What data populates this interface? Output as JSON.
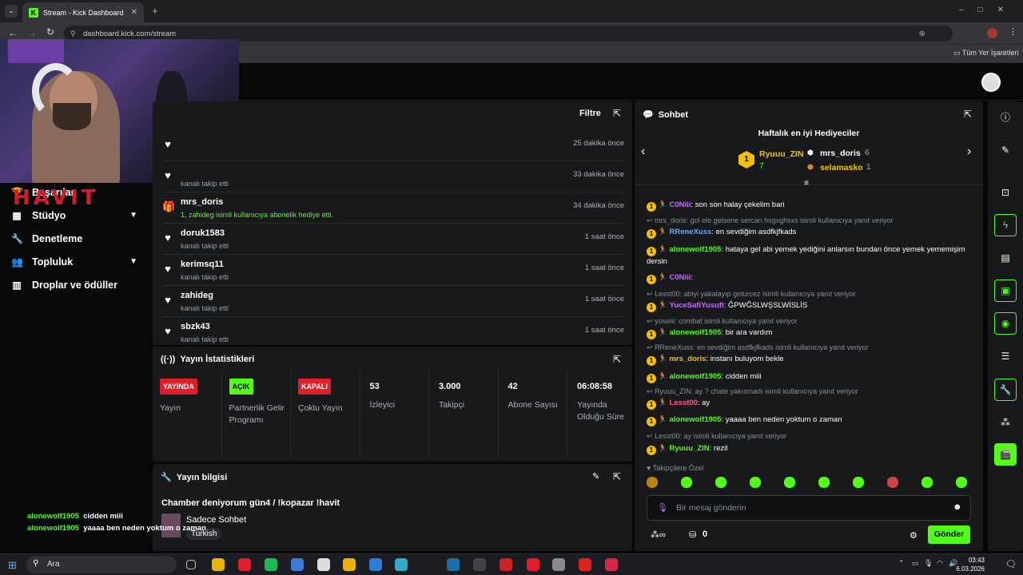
{
  "browser": {
    "tab_title": "Stream - Kick Dashboard",
    "url": "dashboard.kick.com/stream",
    "bookmarks_label": "Tüm Yer İşaretleri"
  },
  "sidebar": {
    "brand": "HAVIT",
    "items": [
      {
        "label": "Başarılar",
        "icon": "trophy-icon"
      },
      {
        "label": "Stüdyo",
        "icon": "studio-icon",
        "chevron": true
      },
      {
        "label": "Denetleme",
        "icon": "wrench-icon"
      },
      {
        "label": "Topluluk",
        "icon": "community-icon",
        "chevron": true
      },
      {
        "label": "Droplar ve ödüller",
        "icon": "drops-icon"
      }
    ]
  },
  "activity": {
    "filter_label": "Filtre",
    "items": [
      {
        "name": "",
        "sub": "",
        "time": "25 dakika önce",
        "icon": "heart-icon"
      },
      {
        "name": "",
        "sub": "kanalı takip etti",
        "time": "33 dakika önce",
        "icon": "heart-icon"
      },
      {
        "name": "mrs_doris",
        "sub": "1, zahideg isimli kullanıcıya abonelik hediye etti.",
        "time": "34 dakika önce",
        "icon": "gift-icon"
      },
      {
        "name": "doruk1583",
        "sub": "kanalı takip etti",
        "time": "1 saat önce",
        "icon": "heart-icon"
      },
      {
        "name": "kerimsq11",
        "sub": "kanalı takip etti",
        "time": "1 saat önce",
        "icon": "heart-icon"
      },
      {
        "name": "zahideg",
        "sub": "kanalı takip etti",
        "time": "1 saat önce",
        "icon": "heart-icon"
      },
      {
        "name": "sbzk43",
        "sub": "kanalı takip etti",
        "time": "1 saat önce",
        "icon": "heart-icon"
      }
    ]
  },
  "stats": {
    "title": "Yayın İstatistikleri",
    "cells": [
      {
        "pill": "YAYINDA",
        "pill_color": "#e11d2b",
        "label": "Yayın"
      },
      {
        "pill": "AÇIK",
        "pill_color": "#53fc18",
        "label": "Partnerlik Gelir Programı"
      },
      {
        "pill": "KAPALI",
        "pill_color": "#e11d2b",
        "label": "Çoklu Yayın"
      },
      {
        "value": "53",
        "label": "İzleyici"
      },
      {
        "value": "3.000",
        "label": "Takipçi"
      },
      {
        "value": "42",
        "label": "Abone Sayısı"
      },
      {
        "value": "06:08:58",
        "label": "Yayında Olduğu Süre"
      }
    ]
  },
  "info": {
    "title": "Yayın bilgisi",
    "stream_title": "Chamber deniyorum gün4 / !kopazar !havit",
    "category": "Sadece Sohbet",
    "language": "Turkish"
  },
  "chat": {
    "title": "Sohbet",
    "gifters_title": "Haftalık en iyi Hediyeciler",
    "gifters": [
      {
        "name": "Ryuuu_ZIN",
        "count": "7"
      },
      {
        "name": "mrs_doris",
        "count": "6"
      },
      {
        "name": "selamasko",
        "count": "1"
      }
    ],
    "messages": [
      {
        "type": "msg",
        "user": "C0Niii",
        "color": "#c86bff",
        "text": ": son son halay çekelim bari"
      },
      {
        "type": "reply",
        "text": "mrs_doris: gol elo gelsene sercan hsgxghsxs isimli kullanıcıya yanıt veriyor"
      },
      {
        "type": "msg",
        "user": "RReneXuss",
        "color": "#6fa8ff",
        "text": ": en sevdiğim asdfkjfkads"
      },
      {
        "type": "msg",
        "user": "alonewolf1905",
        "color": "#53fc18",
        "text": ": hataya gel abi yemek yediğini anlarsın bundan önce yemek yememişim dersin"
      },
      {
        "type": "msg",
        "user": "C0Niii",
        "color": "#c86bff",
        "text": ":"
      },
      {
        "type": "reply",
        "text": "Lesst00: abiyi yakalayıp goturcez isimli kullanıcıya yanıt veriyor"
      },
      {
        "type": "msg",
        "user": "YuceSafiYusufi",
        "color": "#c86bff",
        "text": ": ĞPWĞSLWŞSLWİSLİS"
      },
      {
        "type": "reply",
        "text": "yoseiii: combat isimli kullanıcıya yanıt veriyor"
      },
      {
        "type": "msg",
        "user": "alonewolf1905",
        "color": "#53fc18",
        "text": ": bir ara vardım"
      },
      {
        "type": "reply",
        "text": "RReneXuss: en sevdiğim asdfkjfkads isimli kullanıcıya yanıt veriyor"
      },
      {
        "type": "msg",
        "user": "mrs_doris",
        "color": "#f5c000",
        "text": ": instanı buluyom bekle"
      },
      {
        "type": "msg",
        "user": "alonewolf1905",
        "color": "#53fc18",
        "text": ": cidden miii"
      },
      {
        "type": "reply",
        "text": "Ryuuu_ZIN: ay ? chate yakısmadı isimli kullanıcıya yanıt veriyor"
      },
      {
        "type": "msg",
        "user": "Lesst00",
        "color": "#ff5a8a",
        "text": ": ay"
      },
      {
        "type": "msg",
        "user": "alonewolf1905",
        "color": "#53fc18",
        "text": ": yaaaa ben neden yoktum o zaman"
      },
      {
        "type": "reply",
        "text": "Lesst00: ay isimli kullanıcıya yanıt veriyor"
      },
      {
        "type": "msg",
        "user": "Ryuuu_ZIN",
        "color": "#53fc18",
        "text": ": rezil"
      }
    ],
    "emote_label": "Takipçilere Özel",
    "input_placeholder": "Bir mesaj gönderin",
    "points": "0",
    "send_label": "Gönder"
  },
  "overlay_chat": [
    {
      "user": "alonewolf1905",
      "text": "cidden miii"
    },
    {
      "user": "alonewolf1905",
      "text": "yaaaa ben neden yoktum o zaman"
    }
  ],
  "taskbar": {
    "search_placeholder": "Ara",
    "time": "03:43",
    "date": "6.03.2026"
  }
}
